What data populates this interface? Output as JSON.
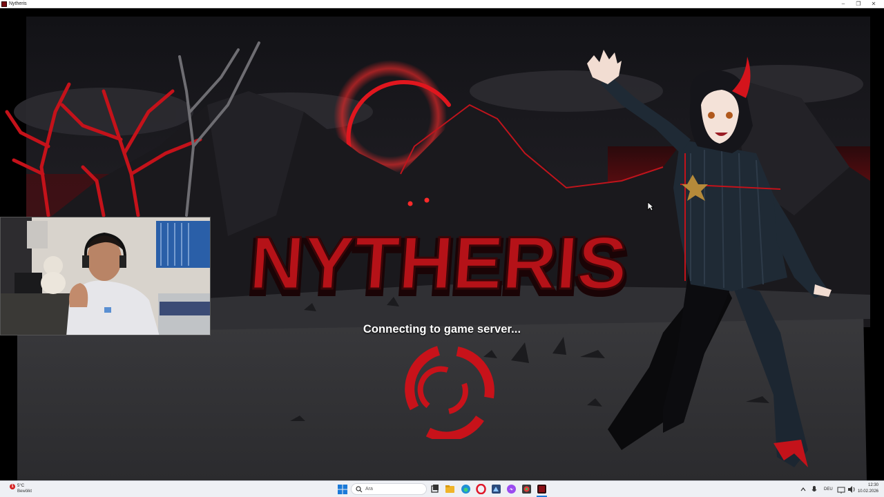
{
  "window": {
    "title": "Nytheris",
    "controls": {
      "minimize": "–",
      "maximize": "❐",
      "close": "✕"
    }
  },
  "game": {
    "logo": "NYTHERIS",
    "status": "Connecting to game server...",
    "accent": "#d4141c",
    "icons": [
      "loading-spinner-icon",
      "cursor-icon"
    ]
  },
  "taskbar": {
    "weather": {
      "temp": "5°C",
      "condition": "Bewölkt",
      "badge": "1"
    },
    "search_placeholder": "Ara",
    "pinned_icons": [
      "start-icon",
      "search-icon",
      "task-view-icon",
      "file-explorer-icon",
      "edge-icon",
      "opera-icon",
      "app-icon",
      "messenger-icon",
      "photos-icon",
      "nytheris-icon"
    ],
    "tray": {
      "language": "DEU",
      "time": "12:30",
      "date": "10.02.2026"
    }
  }
}
